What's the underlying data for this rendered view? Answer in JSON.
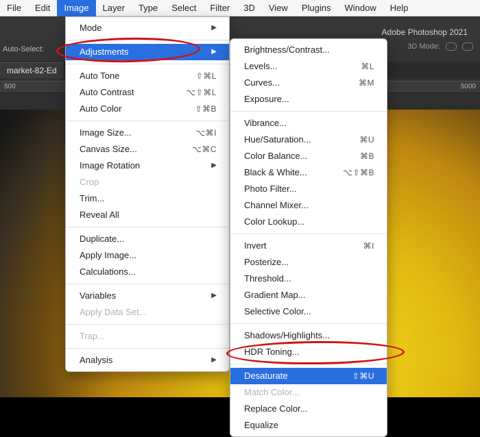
{
  "menubar": {
    "items": [
      "File",
      "Edit",
      "Image",
      "Layer",
      "Type",
      "Select",
      "Filter",
      "3D",
      "View",
      "Plugins",
      "Window",
      "Help"
    ],
    "active_index": 2
  },
  "app_name": "Adobe Photoshop 2021",
  "options_bar": {
    "auto_select_label": "Auto-Select:",
    "threeD_label": "3D Mode:"
  },
  "document_tab": "market-82-Ed",
  "ruler_ticks": [
    "500",
    "",
    "",
    "",
    "",
    "",
    "5000"
  ],
  "image_menu": [
    {
      "type": "item",
      "label": "Mode",
      "submenu": true
    },
    {
      "type": "sep"
    },
    {
      "type": "item",
      "label": "Adjustments",
      "submenu": true,
      "highlight": true
    },
    {
      "type": "sep"
    },
    {
      "type": "item",
      "label": "Auto Tone",
      "shortcut": "⇧⌘L"
    },
    {
      "type": "item",
      "label": "Auto Contrast",
      "shortcut": "⌥⇧⌘L"
    },
    {
      "type": "item",
      "label": "Auto Color",
      "shortcut": "⇧⌘B"
    },
    {
      "type": "sep"
    },
    {
      "type": "item",
      "label": "Image Size...",
      "shortcut": "⌥⌘I"
    },
    {
      "type": "item",
      "label": "Canvas Size...",
      "shortcut": "⌥⌘C"
    },
    {
      "type": "item",
      "label": "Image Rotation",
      "submenu": true
    },
    {
      "type": "item",
      "label": "Crop",
      "disabled": true
    },
    {
      "type": "item",
      "label": "Trim..."
    },
    {
      "type": "item",
      "label": "Reveal All"
    },
    {
      "type": "sep"
    },
    {
      "type": "item",
      "label": "Duplicate..."
    },
    {
      "type": "item",
      "label": "Apply Image..."
    },
    {
      "type": "item",
      "label": "Calculations..."
    },
    {
      "type": "sep"
    },
    {
      "type": "item",
      "label": "Variables",
      "submenu": true
    },
    {
      "type": "item",
      "label": "Apply Data Set...",
      "disabled": true
    },
    {
      "type": "sep"
    },
    {
      "type": "item",
      "label": "Trap...",
      "disabled": true
    },
    {
      "type": "sep"
    },
    {
      "type": "item",
      "label": "Analysis",
      "submenu": true
    }
  ],
  "adjustments_menu": [
    {
      "type": "item",
      "label": "Brightness/Contrast..."
    },
    {
      "type": "item",
      "label": "Levels...",
      "shortcut": "⌘L"
    },
    {
      "type": "item",
      "label": "Curves...",
      "shortcut": "⌘M"
    },
    {
      "type": "item",
      "label": "Exposure..."
    },
    {
      "type": "sep"
    },
    {
      "type": "item",
      "label": "Vibrance..."
    },
    {
      "type": "item",
      "label": "Hue/Saturation...",
      "shortcut": "⌘U"
    },
    {
      "type": "item",
      "label": "Color Balance...",
      "shortcut": "⌘B"
    },
    {
      "type": "item",
      "label": "Black & White...",
      "shortcut": "⌥⇧⌘B"
    },
    {
      "type": "item",
      "label": "Photo Filter..."
    },
    {
      "type": "item",
      "label": "Channel Mixer..."
    },
    {
      "type": "item",
      "label": "Color Lookup..."
    },
    {
      "type": "sep"
    },
    {
      "type": "item",
      "label": "Invert",
      "shortcut": "⌘I"
    },
    {
      "type": "item",
      "label": "Posterize..."
    },
    {
      "type": "item",
      "label": "Threshold..."
    },
    {
      "type": "item",
      "label": "Gradient Map..."
    },
    {
      "type": "item",
      "label": "Selective Color..."
    },
    {
      "type": "sep"
    },
    {
      "type": "item",
      "label": "Shadows/Highlights..."
    },
    {
      "type": "item",
      "label": "HDR Toning..."
    },
    {
      "type": "sep"
    },
    {
      "type": "item",
      "label": "Desaturate",
      "shortcut": "⇧⌘U",
      "highlight": true
    },
    {
      "type": "item",
      "label": "Match Color...",
      "disabled": true
    },
    {
      "type": "item",
      "label": "Replace Color..."
    },
    {
      "type": "item",
      "label": "Equalize"
    }
  ]
}
